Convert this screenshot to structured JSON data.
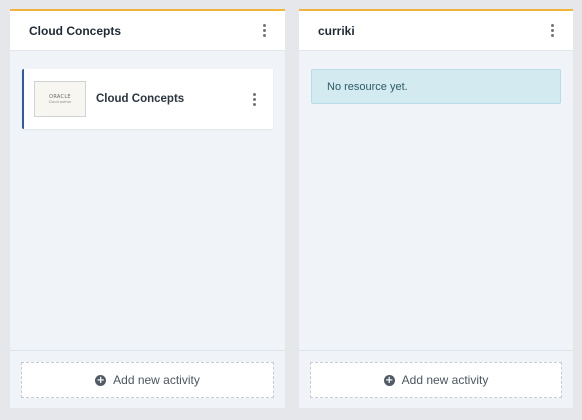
{
  "columns": [
    {
      "title": "Cloud Concepts",
      "resources": [
        {
          "title": "Cloud Concepts",
          "thumbnail": {
            "brand": "ORACLE",
            "subtitle": "Cloud author"
          }
        }
      ],
      "add_label": "Add new activity"
    },
    {
      "title": "curriki",
      "empty_message": "No resource yet.",
      "add_label": "Add new activity"
    }
  ],
  "colors": {
    "accent": "#f1b33c",
    "card_border": "#2e5aa8",
    "notice_bg": "#d2eaf0"
  },
  "icons": {
    "menu": "kebab-menu-icon",
    "add": "plus-circle-icon"
  }
}
